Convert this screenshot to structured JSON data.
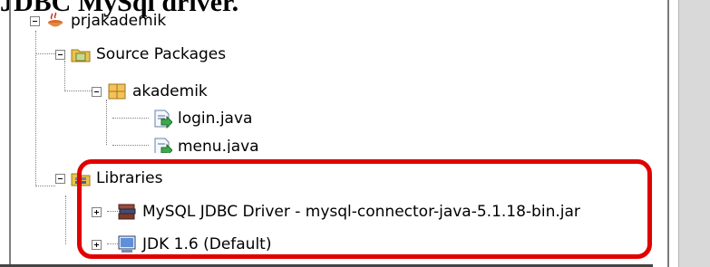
{
  "heading": "JDBC MySql driver.",
  "tree": {
    "project": "prjakademik",
    "source_packages": "Source Packages",
    "package": "akademik",
    "files": [
      "login.java",
      "menu.java"
    ],
    "libraries": "Libraries",
    "library_items": [
      "MySQL JDBC Driver - mysql-connector-java-5.1.18-bin.jar",
      "JDK 1.6 (Default)"
    ]
  },
  "colors": {
    "highlight": "#e00000"
  }
}
